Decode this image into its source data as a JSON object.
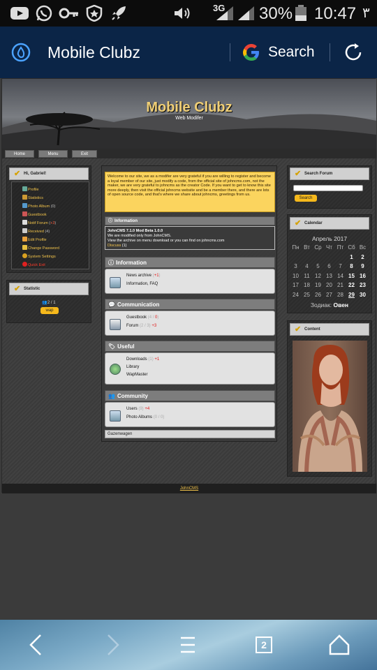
{
  "status_bar": {
    "network_type": "3G",
    "battery_percent": "30%",
    "time": "10:47",
    "extra_glyph": "٣",
    "icons": [
      "youtube-icon",
      "whatsapp-icon",
      "key-icon",
      "shield-icon",
      "rocket-icon",
      "volume-icon",
      "signal-icon",
      "signal-icon",
      "battery-icon"
    ]
  },
  "browser_bar": {
    "title": "Mobile Clubz",
    "search_label": "Search",
    "icons": [
      "drop-icon",
      "google-icon",
      "refresh-icon"
    ]
  },
  "site": {
    "title": "Mobile Clubz",
    "subtitle": "Web Modifer",
    "nav": [
      "Home",
      "Menu",
      "Exit"
    ],
    "left_panel": {
      "greeting": "Hi, Gabriel!",
      "menu": [
        {
          "label": "Profile",
          "color": "#f0c24a"
        },
        {
          "label": "Statistics",
          "color": "#f0c24a"
        },
        {
          "label": "Photo Album",
          "suffix": "(0)"
        },
        {
          "label": "Guestbook",
          "color": "#f0c24a"
        },
        {
          "label": "Notif Forum",
          "suffix": "(",
          "suffix_red": "+3",
          "suffix_end": ")"
        },
        {
          "label": "Received",
          "suffix": "(4)"
        },
        {
          "label": "Edit Profile",
          "color": "#f0c24a"
        },
        {
          "label": "Change Password",
          "color": "#f0c24a"
        },
        {
          "label": "System Settings",
          "color": "#f0c24a"
        },
        {
          "label": "Quick Exit",
          "color": "#ff3a2a"
        }
      ]
    },
    "statistic": {
      "title": "Statistic",
      "online": "2 / 1",
      "badge": "wap"
    },
    "notice": "Welcome to our site, we as a modifer are very grateful if you are willing to register and become a loyal member of our site, just modify a code, from the official site of johncms.com, not the maker, we are very grateful to johncms as the creator Code. If you want to get to know this site more deeply, then visit the official johncms website and be a member there, and there are lots of open source code, and that's where we share about johncms, greetings from us.",
    "info_header": "Information",
    "info": {
      "line1": "JohnCMS 7.1.0 Mod Beta 1.0.0",
      "line2": "We are modified only from JohnCMS.",
      "line3": "View the archive on menu download or you can find on johncms.com",
      "discuss": "Discuss",
      "discuss_count": "(1)"
    },
    "sections": [
      {
        "title": "Information",
        "icon": "info-circle-icon",
        "lines": [
          {
            "label": "News archive",
            "count": " (",
            "plus": "+1",
            "end": ")"
          },
          {
            "label": "Information, FAQ"
          }
        ]
      },
      {
        "title": "Communication",
        "icon": "chat-icon",
        "lines": [
          {
            "label": "Guestbook",
            "count": " (4 / ",
            "plus": "0",
            "end": ")"
          },
          {
            "label": "Forum",
            "count": " (2 / 3) ",
            "plus": "+3",
            "end": ""
          }
        ]
      },
      {
        "title": "Useful",
        "icon": "tag-icon",
        "lines": [
          {
            "label": "Downloads",
            "count": " (1) ",
            "plus": "+1",
            "end": ""
          },
          {
            "label": "Library"
          },
          {
            "label": "WapMaster"
          }
        ]
      },
      {
        "title": "Community",
        "icon": "users-icon",
        "lines": [
          {
            "label": "Users",
            "count": " (9) ",
            "plus": "+4",
            "end": ""
          },
          {
            "label": "Photo Albums",
            "count": " (0 / 0)"
          }
        ]
      }
    ],
    "bottom_link": "Gazenwagen",
    "right": {
      "search_title": "Search Forum",
      "search_button": "Search",
      "calendar_title": "Calendar",
      "month": "Апрель 2017",
      "weekdays": [
        "Пн",
        "Вт",
        "Ср",
        "Чт",
        "Пт",
        "Сб",
        "Вс"
      ],
      "weeks": [
        [
          "",
          "",
          "",
          "",
          "",
          "1",
          "2"
        ],
        [
          "3",
          "4",
          "5",
          "6",
          "7",
          "8",
          "9"
        ],
        [
          "10",
          "11",
          "12",
          "13",
          "14",
          "15",
          "16"
        ],
        [
          "17",
          "18",
          "19",
          "20",
          "21",
          "22",
          "23"
        ],
        [
          "24",
          "25",
          "26",
          "27",
          "28",
          "29",
          "30"
        ]
      ],
      "today": "29",
      "zodiac_label": "Зодиак:",
      "zodiac_value": "Овен",
      "content_title": "Content"
    },
    "footer": "JohnCMS"
  },
  "bottom_nav": {
    "tab_count": "2",
    "icons": [
      "back-icon",
      "forward-icon",
      "menu-icon",
      "tabs-icon",
      "home-icon"
    ]
  }
}
